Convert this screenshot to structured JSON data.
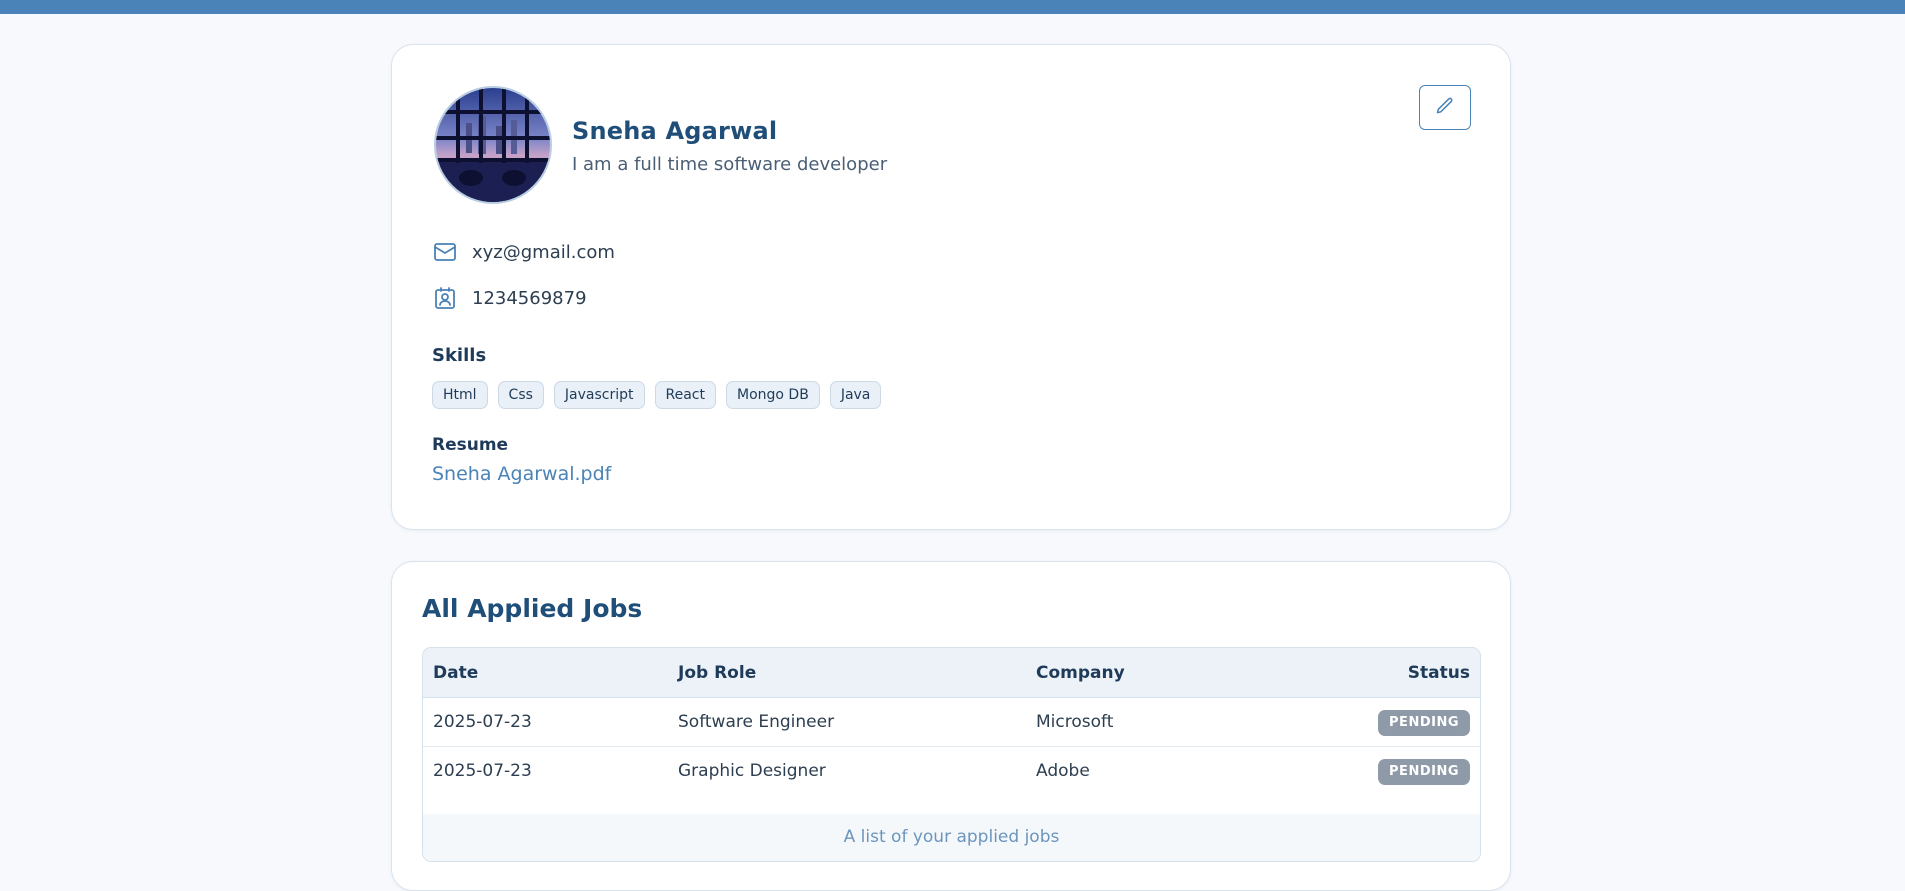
{
  "theme": {
    "accent": "#4a83b7",
    "badge_pending": "#8e9aa7",
    "background": "#f7f9fc"
  },
  "profile": {
    "name": "Sneha Agarwal",
    "bio": "I am a full time software developer",
    "avatar": "city-window-night-image",
    "edit_icon": "pencil-icon",
    "email_icon": "mail-icon",
    "phone_icon": "contact-card-icon",
    "email": "xyz@gmail.com",
    "phone": "1234569879",
    "skills_title": "Skills",
    "skills": [
      "Html",
      "Css",
      "Javascript",
      "React",
      "Mongo DB",
      "Java"
    ],
    "resume_title": "Resume",
    "resume_file": "Sneha Agarwal.pdf"
  },
  "jobs": {
    "title": "All Applied Jobs",
    "columns": [
      "Date",
      "Job Role",
      "Company",
      "Status"
    ],
    "rows": [
      {
        "date": "2025-07-23",
        "role": "Software Engineer",
        "company": "Microsoft",
        "status": "PENDING"
      },
      {
        "date": "2025-07-23",
        "role": "Graphic Designer",
        "company": "Adobe",
        "status": "PENDING"
      }
    ],
    "caption": "A list of your applied jobs"
  }
}
